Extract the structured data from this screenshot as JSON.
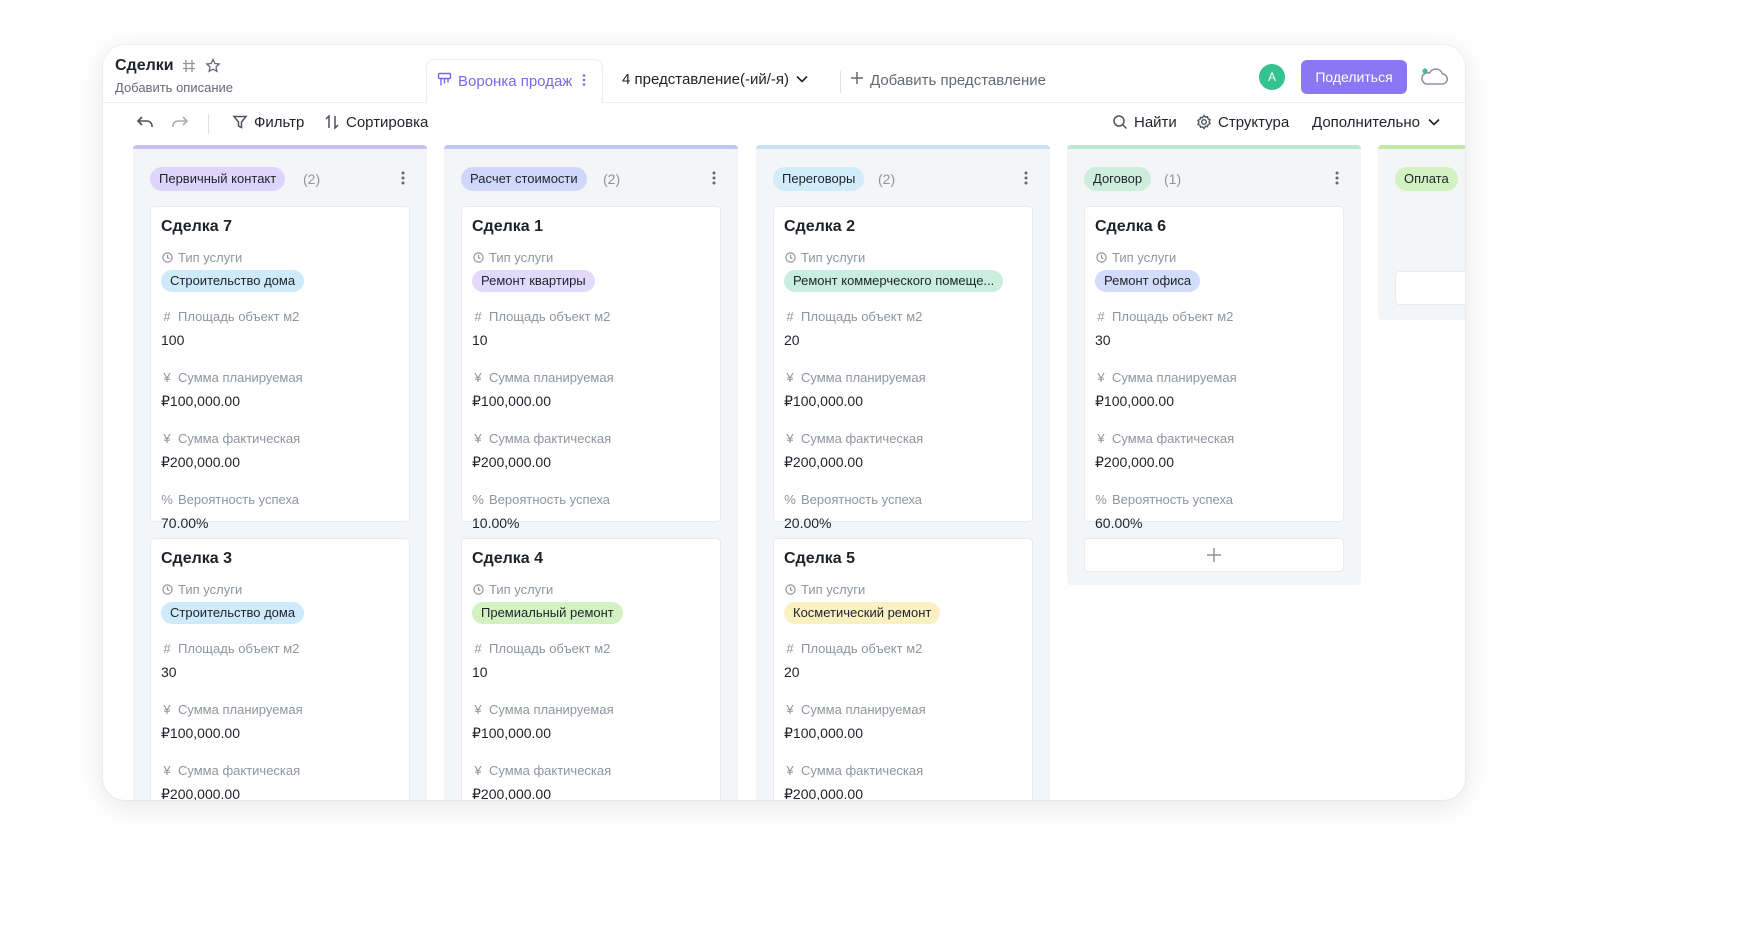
{
  "header": {
    "title": "Сделки",
    "description": "Добавить описание",
    "active_view": "Воронка продаж",
    "views_count": "4 представление(-ий/-я)",
    "add_view": "Добавить представление",
    "avatar_letter": "A",
    "share_label": "Поделиться"
  },
  "toolbar": {
    "filter": "Фильтр",
    "sort": "Сортировка",
    "find": "Найти",
    "structure": "Структура",
    "more": "Дополнительно"
  },
  "fields": {
    "service": "Тип услуги",
    "area": "Площадь объект м2",
    "planned": "Сумма планируемая",
    "actual": "Сумма фактическая",
    "probability": "Вероятность успеха"
  },
  "columns": [
    {
      "stage": "Первичный контакт",
      "count": "(2)",
      "color": "#ddd5fb",
      "bar": "#c9bff5",
      "cards": [
        {
          "title": "Сделка 7",
          "service": "Строительство дома",
          "service_color": "#cfeafb",
          "area": "100",
          "planned": "₽100,000.00",
          "actual": "₽200,000.00",
          "probability": "70.00%"
        },
        {
          "title": "Сделка 3",
          "service": "Строительство дома",
          "service_color": "#cfeafb",
          "area": "30",
          "planned": "₽100,000.00",
          "actual": "₽200,000.00"
        }
      ]
    },
    {
      "stage": "Расчет стоимости",
      "count": "(2)",
      "color": "#cfd8fb",
      "bar": "#bdc8f7",
      "cards": [
        {
          "title": "Сделка 1",
          "service": "Ремонт квартиры",
          "service_color": "#e2dafc",
          "area": "10",
          "planned": "₽100,000.00",
          "actual": "₽200,000.00",
          "probability": "10.00%"
        },
        {
          "title": "Сделка 4",
          "service": "Премиальный ремонт",
          "service_color": "#d3f2c4",
          "area": "10",
          "planned": "₽100,000.00",
          "actual": "₽200,000.00"
        }
      ]
    },
    {
      "stage": "Переговоры",
      "count": "(2)",
      "color": "#d3ecfb",
      "bar": "#c5e4f8",
      "cards": [
        {
          "title": "Сделка 2",
          "service": "Ремонт коммерческого помеще...",
          "service_color": "#c9eedf",
          "area": "20",
          "planned": "₽100,000.00",
          "actual": "₽200,000.00",
          "probability": "20.00%"
        },
        {
          "title": "Сделка 5",
          "service": "Косметический ремонт",
          "service_color": "#fbf0c2",
          "area": "20",
          "planned": "₽100,000.00",
          "actual": "₽200,000.00"
        }
      ]
    },
    {
      "stage": "Договор",
      "count": "(1)",
      "color": "#cdeedd",
      "bar": "#bfe8d2",
      "cards": [
        {
          "title": "Сделка 6",
          "service": "Ремонт офиса",
          "service_color": "#d2dcfb",
          "area": "30",
          "planned": "₽100,000.00",
          "actual": "₽200,000.00",
          "probability": "60.00%"
        }
      ]
    },
    {
      "stage": "Оплата",
      "count": "",
      "color": "#d3f2c4",
      "bar": "#c2e9a8",
      "cards": []
    }
  ]
}
